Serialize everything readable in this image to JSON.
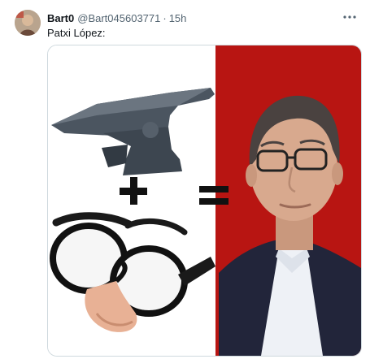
{
  "tweet": {
    "display_name": "Bart0",
    "handle": "@Bart045603771",
    "separator": "·",
    "time": "15h",
    "text": "Patxi López:",
    "more_icon": "ellipsis-icon"
  },
  "media": {
    "description_icons": [
      "anvil-icon",
      "plus-icon",
      "equals-icon",
      "disguise-glasses-icon",
      "portrait-photo"
    ],
    "colors": {
      "left_bg": "#ffffff",
      "right_bg": "#b81512",
      "anvil": "#4b5560",
      "symbols": "#111111",
      "jacket": "#22253a",
      "shirt": "#eef1f6",
      "skin": "#d8a98e",
      "hair": "#4a4240"
    }
  }
}
